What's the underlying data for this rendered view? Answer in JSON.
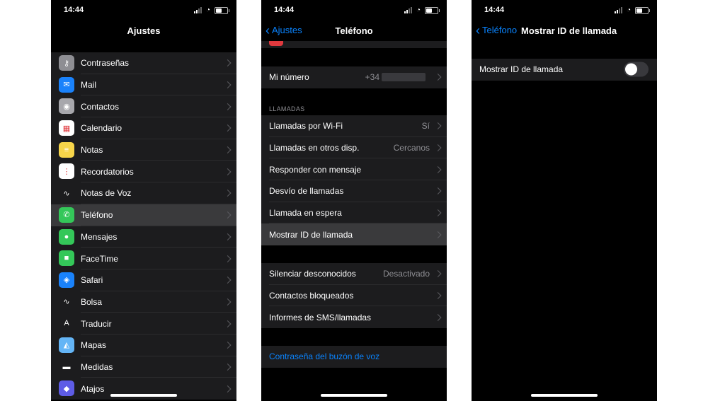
{
  "status": {
    "time": "14:44"
  },
  "screen1": {
    "title": "Ajustes",
    "items": [
      {
        "label": "Contraseñas",
        "icon": "key-icon",
        "color": "#8e8e93",
        "glyph": "⚷"
      },
      {
        "label": "Mail",
        "icon": "mail-icon",
        "color": "#1a82fb",
        "glyph": "✉"
      },
      {
        "label": "Contactos",
        "icon": "contacts-icon",
        "color": "#a7a7ac",
        "glyph": "◉"
      },
      {
        "label": "Calendario",
        "icon": "calendar-icon",
        "color": "#ffffff",
        "glyph": "▦"
      },
      {
        "label": "Notas",
        "icon": "notes-icon",
        "color": "#f7d54a",
        "glyph": "≡"
      },
      {
        "label": "Recordatorios",
        "icon": "reminders-icon",
        "color": "#ffffff",
        "glyph": "⋮"
      },
      {
        "label": "Notas de Voz",
        "icon": "voice-memos-icon",
        "color": "#1c1c1e",
        "glyph": "∿"
      },
      {
        "label": "Teléfono",
        "icon": "phone-icon",
        "color": "#34c759",
        "glyph": "✆"
      },
      {
        "label": "Mensajes",
        "icon": "messages-icon",
        "color": "#34c759",
        "glyph": "●"
      },
      {
        "label": "FaceTime",
        "icon": "facetime-icon",
        "color": "#34c759",
        "glyph": "■"
      },
      {
        "label": "Safari",
        "icon": "safari-icon",
        "color": "#1a82fb",
        "glyph": "◈"
      },
      {
        "label": "Bolsa",
        "icon": "stocks-icon",
        "color": "#1c1c1e",
        "glyph": "∿"
      },
      {
        "label": "Traducir",
        "icon": "translate-icon",
        "color": "#1c1c1e",
        "glyph": "A"
      },
      {
        "label": "Mapas",
        "icon": "maps-icon",
        "color": "#64b5f6",
        "glyph": "◭"
      },
      {
        "label": "Medidas",
        "icon": "measure-icon",
        "color": "#1c1c1e",
        "glyph": "▬"
      },
      {
        "label": "Atajos",
        "icon": "shortcuts-icon",
        "color": "#5e5ce6",
        "glyph": "◆"
      }
    ]
  },
  "screen2": {
    "back": "Ajustes",
    "title": "Teléfono",
    "my_number": {
      "label": "Mi número",
      "value": "+34"
    },
    "section": "LLAMADAS",
    "calls": [
      {
        "label": "Llamadas por Wi-Fi",
        "value": "Sí"
      },
      {
        "label": "Llamadas en otros disp.",
        "value": "Cercanos"
      },
      {
        "label": "Responder con mensaje",
        "value": ""
      },
      {
        "label": "Desvío de llamadas",
        "value": ""
      },
      {
        "label": "Llamada en espera",
        "value": ""
      },
      {
        "label": "Mostrar ID de llamada",
        "value": ""
      }
    ],
    "blocking": [
      {
        "label": "Silenciar desconocidos",
        "value": "Desactivado"
      },
      {
        "label": "Contactos bloqueados",
        "value": ""
      },
      {
        "label": "Informes de SMS/llamadas",
        "value": ""
      }
    ],
    "voicemail": "Contraseña del buzón de voz"
  },
  "screen3": {
    "back": "Teléfono",
    "title": "Mostrar ID de llamada",
    "toggle_label": "Mostrar ID de llamada",
    "toggle_on": false
  }
}
